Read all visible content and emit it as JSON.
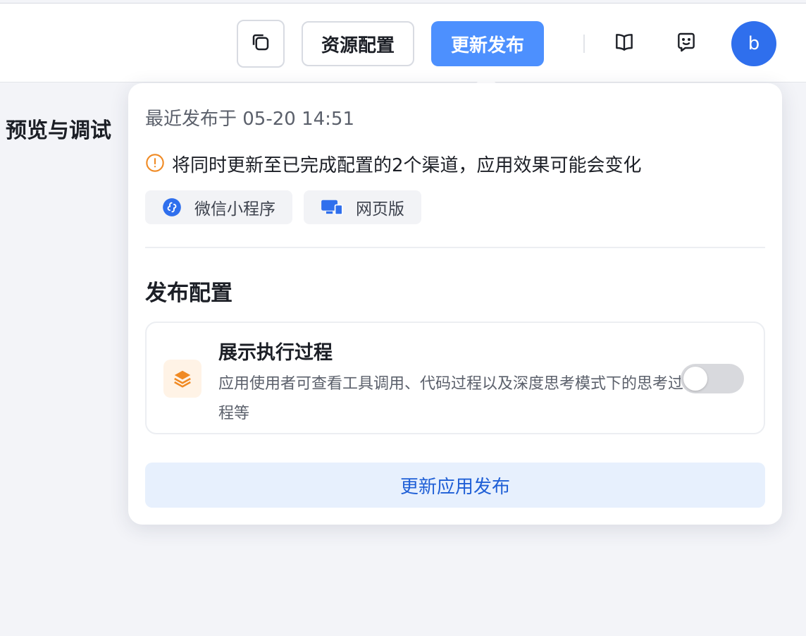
{
  "header": {
    "resource_config_label": "资源配置",
    "publish_label": "更新发布",
    "avatar_letter": "b"
  },
  "main": {
    "preview_title": "预览与调试"
  },
  "popover": {
    "last_publish": "最近发布于 05-20 14:51",
    "warning": "将同时更新至已完成配置的2个渠道，应用效果可能会变化",
    "channels": [
      {
        "label": "微信小程序",
        "icon": "wechat-miniprogram-icon"
      },
      {
        "label": "网页版",
        "icon": "web-icon"
      }
    ],
    "section_title": "发布配置",
    "option": {
      "title": "展示执行过程",
      "description": "应用使用者可查看工具调用、代码过程以及深度思考模式下的思考过程等",
      "enabled": false
    },
    "update_button": "更新应用发布"
  },
  "colors": {
    "accent": "#4d90fe",
    "avatar": "#2f6fed",
    "warning": "#f08a24",
    "primary_text": "#1f5fd6"
  }
}
